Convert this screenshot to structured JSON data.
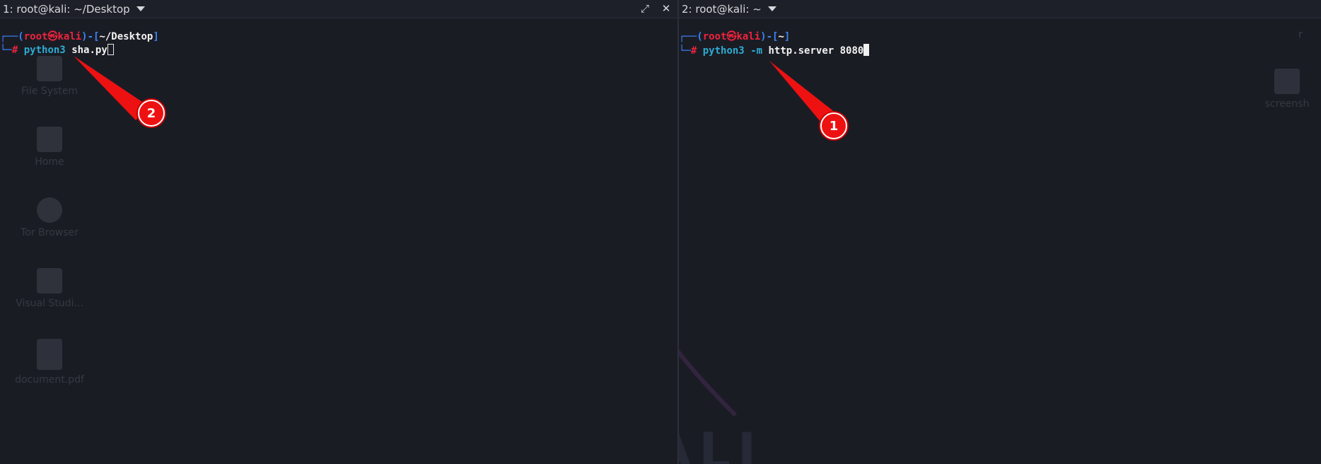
{
  "left_terminal": {
    "tab_title": "1: root@kali: ~/Desktop",
    "maximize_glyph": "⤢",
    "close_glyph": "✕",
    "prompt": {
      "corner_top": "┌──(",
      "user": "root",
      "at_glyph": "㉿",
      "host": "kali",
      "sep": ")-[",
      "path": "~/Desktop",
      "end": "]",
      "corner_bottom": "└─",
      "hash": "#"
    },
    "command": {
      "program": "python3",
      "args": "sha.py"
    }
  },
  "right_terminal": {
    "tab_title": "2: root@kali: ~",
    "prompt": {
      "corner_top": "┌──(",
      "user": "root",
      "at_glyph": "㉿",
      "host": "kali",
      "sep": ")-[",
      "path": "~",
      "end": "]",
      "corner_bottom": "└─",
      "hash": "#"
    },
    "command": {
      "program": "python3",
      "flag": "-m",
      "args": "http.server 8080"
    },
    "corner_text": "r"
  },
  "desktop_icons": [
    {
      "label": "File System",
      "icon": "disk-icon"
    },
    {
      "label": "Home",
      "icon": "folder-icon"
    },
    {
      "label": "Tor Browser",
      "icon": "tor-icon"
    },
    {
      "label": "Visual Studi...",
      "icon": "vscode-icon"
    },
    {
      "label": "document.pdf",
      "icon": "file-icon"
    }
  ],
  "desktop_icons_right": [
    {
      "label": "screensh",
      "icon": "image-icon"
    }
  ],
  "annotations": [
    {
      "number": "1",
      "color": "#e11111"
    },
    {
      "number": "2",
      "color": "#e11111"
    }
  ],
  "wallpaper_text": "KALI"
}
